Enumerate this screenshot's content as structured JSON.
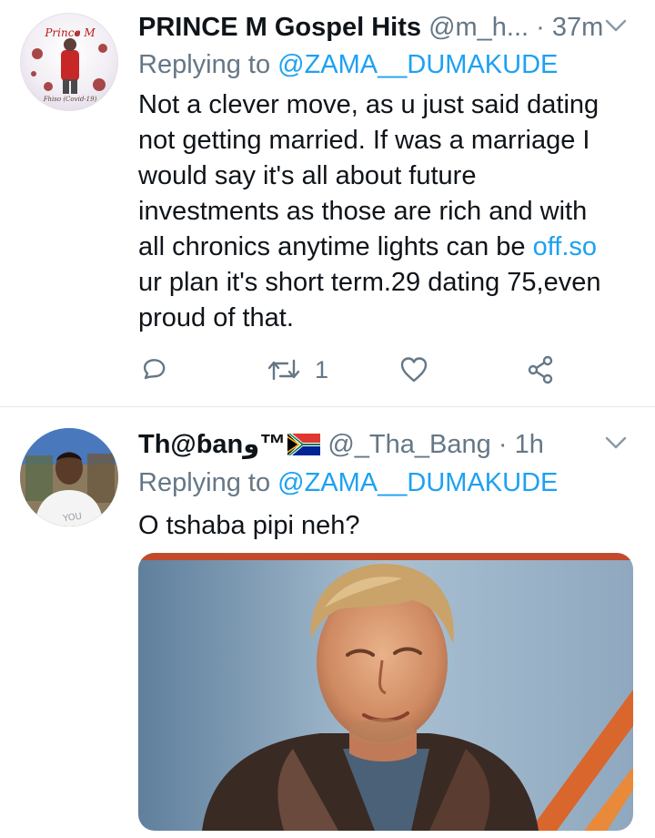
{
  "tweets": [
    {
      "author_name": "PRINCE M Gospel Hits",
      "handle": "@m_h...",
      "dot": "·",
      "time": "37m",
      "avatar_text_top": "Prince M",
      "avatar_text_bottom": "Fhiso (Covid-19)",
      "replying_prefix": "Replying to ",
      "replying_to": "@ZAMA__DUMAKUDE",
      "body_lines": [
        "Not a clever move, as u just said dating",
        "not getting married. If was a marriage I",
        "would say it's all about future",
        "investments as those are rich and with",
        "all chronics anytime lights can be "
      ],
      "link_text": "off.so",
      "body_after_link": [
        "ur plan it's short term.29 dating 75,even",
        "proud of that."
      ],
      "retweet_count": "1",
      "icons": [
        "reply-icon",
        "retweet-icon",
        "like-icon",
        "share-icon",
        "caret-down-icon"
      ]
    },
    {
      "author_name": "Th@ɓanو™",
      "handle": "@_Tha_Bang",
      "dot": "·",
      "time": "1h",
      "flag": "south-africa-flag-icon",
      "avatar_text_shirt": "YOU",
      "replying_prefix": "Replying to ",
      "replying_to": "@ZAMA__DUMAKUDE",
      "body": "O tshaba pipi neh?",
      "media": "photo of a blond man in a leather jacket"
    }
  ],
  "colors": {
    "text": "#0f1419",
    "secondary": "#657786",
    "accent": "#1da1f2",
    "divider": "#e1e8ed"
  }
}
